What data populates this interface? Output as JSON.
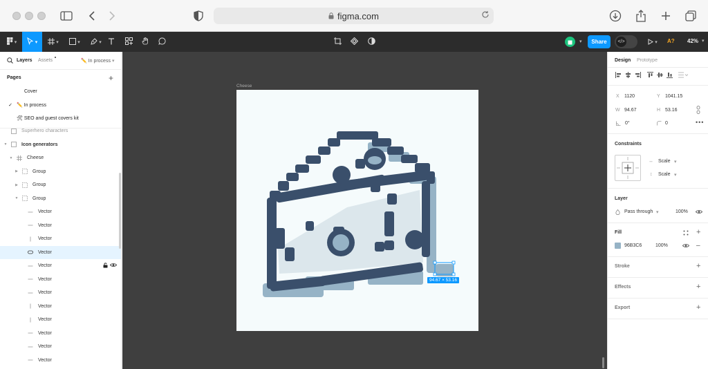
{
  "browser": {
    "url": "figma.com"
  },
  "toolbar": {
    "share_label": "Share",
    "zoom": "42%",
    "user_initial": "A?"
  },
  "left_panel": {
    "tabs": {
      "layers": "Layers",
      "assets": "Assets",
      "page_selector": "✏️ In process"
    },
    "pages_heading": "Pages",
    "pages": [
      {
        "label": "Cover"
      },
      {
        "label": "✏️ In process",
        "checked": true
      },
      {
        "label": "🛠 SEO and guest covers kit"
      }
    ],
    "layers": [
      {
        "label": "Superhero characters",
        "indent": 0,
        "icon": "frame"
      },
      {
        "label": "Icon generators",
        "indent": 0,
        "icon": "frame",
        "bold": true
      },
      {
        "label": "Cheese",
        "indent": 1,
        "icon": "hash"
      },
      {
        "label": "Group",
        "indent": 2,
        "icon": "group"
      },
      {
        "label": "Group",
        "indent": 2,
        "icon": "group"
      },
      {
        "label": "Group",
        "indent": 2,
        "icon": "group"
      },
      {
        "label": "Vector",
        "indent": 3,
        "icon": "line"
      },
      {
        "label": "Vector",
        "indent": 3,
        "icon": "line"
      },
      {
        "label": "Vector",
        "indent": 3,
        "icon": "vline"
      },
      {
        "label": "Vector",
        "indent": 3,
        "icon": "pill",
        "selected": true
      },
      {
        "label": "Vector",
        "indent": 3,
        "icon": "line",
        "hover": true
      },
      {
        "label": "Vector",
        "indent": 3,
        "icon": "line"
      },
      {
        "label": "Vector",
        "indent": 3,
        "icon": "line"
      },
      {
        "label": "Vector",
        "indent": 3,
        "icon": "vline"
      },
      {
        "label": "Vector",
        "indent": 3,
        "icon": "vline"
      },
      {
        "label": "Vector",
        "indent": 3,
        "icon": "line"
      },
      {
        "label": "Vector",
        "indent": 3,
        "icon": "line"
      },
      {
        "label": "Vector",
        "indent": 3,
        "icon": "line"
      }
    ]
  },
  "canvas": {
    "frame_name": "Cheese",
    "selection_size": "94.67 × 53.16"
  },
  "right_panel": {
    "tabs": {
      "design": "Design",
      "prototype": "Prototype"
    },
    "x_label": "X",
    "x": "1120",
    "y_label": "Y",
    "y": "1041.15",
    "w_label": "W",
    "w": "94.67",
    "h_label": "H",
    "h": "53.16",
    "rotation": "0°",
    "radius": "0",
    "constraints_heading": "Constraints",
    "constraint_h": "Scale",
    "constraint_v": "Scale",
    "layer_heading": "Layer",
    "blend_mode": "Pass through",
    "layer_opacity": "100%",
    "fill_heading": "Fill",
    "fill_hex": "96B3C6",
    "fill_opacity": "100%",
    "stroke_heading": "Stroke",
    "effects_heading": "Effects",
    "export_heading": "Export"
  },
  "colors": {
    "accent": "#0d99ff",
    "cheese_dark": "#3a4f6b",
    "cheese_mid": "#96b3c6",
    "cheese_light": "#dce7ec"
  }
}
